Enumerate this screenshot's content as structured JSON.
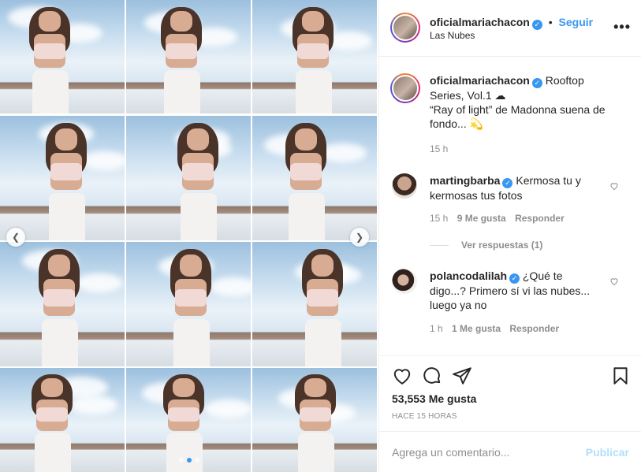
{
  "header": {
    "username": "oficialmariachacon",
    "separator": "•",
    "follow_label": "Seguir",
    "location": "Las Nubes",
    "more_label": "•••"
  },
  "caption": {
    "username": "oficialmariachacon",
    "text_line1": "Rooftop",
    "text_line2": "Series, Vol.1 ☁",
    "text_line3": "“Ray of light” de Madonna suena de",
    "text_line4": "fondo... 💫",
    "time": "15 h"
  },
  "comments": [
    {
      "username": "martingbarba",
      "text_a": "Kermosa tu y",
      "text_b": "kermosas tus fotos",
      "time": "15 h",
      "likes": "9 Me gusta",
      "reply_label": "Responder",
      "view_replies": "Ver respuestas (1)"
    },
    {
      "username": "polancodalilah",
      "text_a": "¿Qué te",
      "text_b": "digo...? Primero sí vi las nubes...",
      "text_c": "luego ya no",
      "time": "1 h",
      "likes": "1 Me gusta",
      "reply_label": "Responder"
    }
  ],
  "actions": {
    "icons": [
      "heart-icon",
      "comment-icon",
      "share-icon",
      "bookmark-icon"
    ],
    "likes": "53,553 Me gusta",
    "time_ago": "HACE 15 HORAS"
  },
  "add_comment": {
    "placeholder": "Agrega un comentario...",
    "publish_label": "Publicar"
  },
  "carousel": {
    "dots": 3,
    "active_dot": 1,
    "prev_icon": "chevron-left-icon",
    "next_icon": "chevron-right-icon"
  },
  "colors": {
    "link": "#3897f0",
    "muted": "#8e8e8e",
    "publish_disabled": "#b2dffc"
  }
}
